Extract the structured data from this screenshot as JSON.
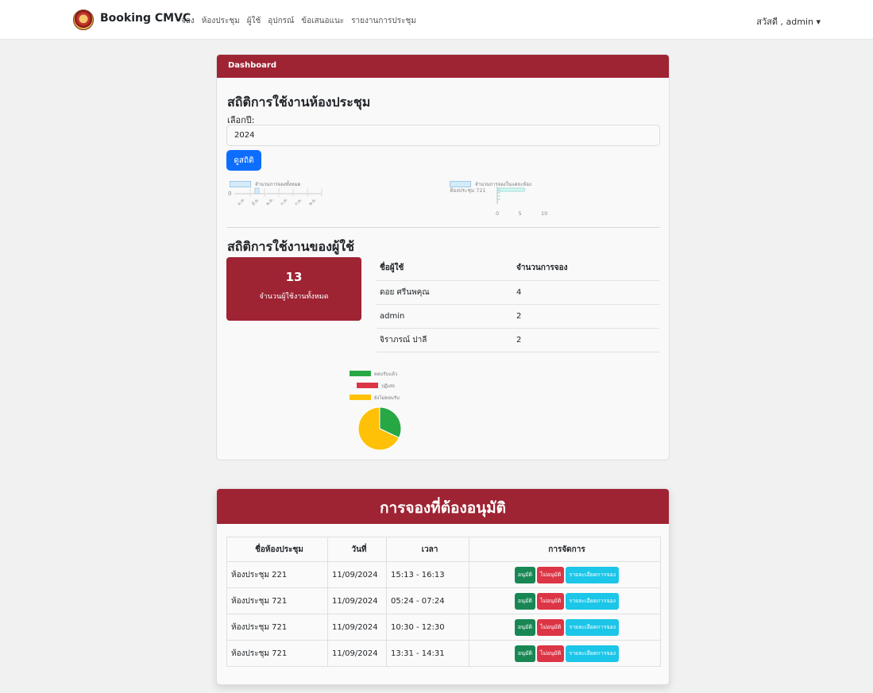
{
  "nav": {
    "brand": "Booking CMVC",
    "links": [
      "จอง",
      "ห้องประชุม",
      "ผู้ใช้",
      "อุปกรณ์",
      "ข้อเสนอแนะ",
      "รายงานการประชุม"
    ],
    "user": "สวัสดี , admin ▾"
  },
  "dashboard": {
    "header": "Dashboard",
    "room_stats_title": "สถิติการใช้งานห้องประชุม",
    "year_label": "เลือกปี:",
    "year_value": "2024",
    "view_button": "ดูสถิติ",
    "user_stats_title": "สถิติการใช้งานของผู้ใช้",
    "total_users": "13",
    "total_users_label": "จำนวนผู้ใช้งานทั้งหมด",
    "user_table": {
      "headers": [
        "ชื่อผู้ใช้",
        "จำนวนการจอง"
      ],
      "rows": [
        [
          "ดอย ศรีนพคุณ",
          "4"
        ],
        [
          "admin",
          "2"
        ],
        [
          "จิราภรณ์ ปาลี",
          "2"
        ]
      ]
    }
  },
  "chart_data": [
    {
      "type": "bar",
      "legend": "จำนวนการจองทั้งหมด",
      "categories": [
        "ม.ค.",
        "มิ.ย.",
        "พ.ค.",
        "ก.ค.",
        "ก.ย.",
        "พ.ย."
      ],
      "values": [
        0,
        1,
        0,
        0,
        0,
        0
      ],
      "ytick": "0"
    },
    {
      "type": "bar",
      "orientation": "horizontal",
      "legend": "จำนวนการจองในแต่ละห้อง",
      "categories": [
        "ห้องประชุม 721"
      ],
      "values": [
        6
      ],
      "xticks": [
        "0",
        "5",
        "10"
      ],
      "xlim": [
        0,
        10
      ]
    },
    {
      "type": "pie",
      "labels": [
        "ตอบรับแล้ว",
        "ปฏิเสธ",
        "ยังไม่ตอบรับ"
      ],
      "values": [
        32,
        0,
        68
      ],
      "colors": [
        "#28a745",
        "#dc3545",
        "#ffc107"
      ]
    }
  ],
  "approvals": {
    "title": "การจองที่ต้องอนุมัติ",
    "headers": [
      "ชื่อห้องประชุม",
      "วันที่",
      "เวลา",
      "การจัดการ"
    ],
    "rows": [
      [
        "ห้องประชุม 221",
        "11/09/2024",
        "15:13 - 16:13"
      ],
      [
        "ห้องประชุม 721",
        "11/09/2024",
        "05:24 - 07:24"
      ],
      [
        "ห้องประชุม 721",
        "11/09/2024",
        "10:30 - 12:30"
      ],
      [
        "ห้องประชุม 721",
        "11/09/2024",
        "13:31 - 14:31"
      ]
    ],
    "approve_label": "อนุมัติ",
    "reject_label": "ไม่อนุมัติ",
    "detail_label": "รายละเอียดการจอง"
  }
}
